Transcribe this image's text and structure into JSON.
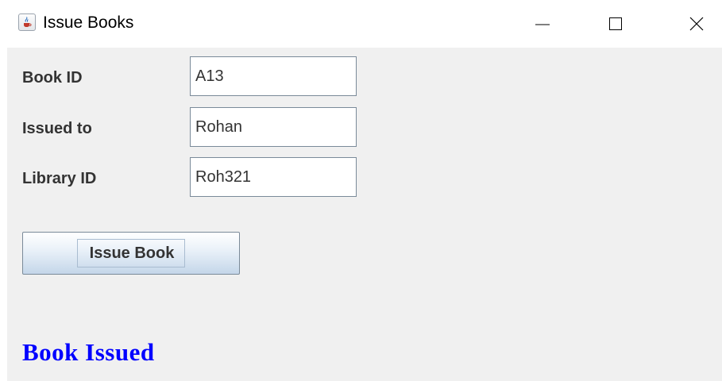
{
  "window": {
    "title": "Issue Books",
    "icon": "java-cup-icon",
    "controls": [
      "minimize-icon",
      "maximize-icon",
      "close-icon"
    ]
  },
  "form": {
    "book_id": {
      "label": "Book ID",
      "value": "A13"
    },
    "issued_to": {
      "label": "Issued to",
      "value": "Rohan"
    },
    "library_id": {
      "label": "Library ID",
      "value": "Roh321"
    }
  },
  "actions": {
    "issue_label": "Issue Book"
  },
  "status": {
    "message": "Book Issued",
    "color": "#0000ff"
  },
  "colors": {
    "panel_background": "#f0f0f0",
    "field_border": "#7a8a99",
    "label_text": "#333333"
  }
}
